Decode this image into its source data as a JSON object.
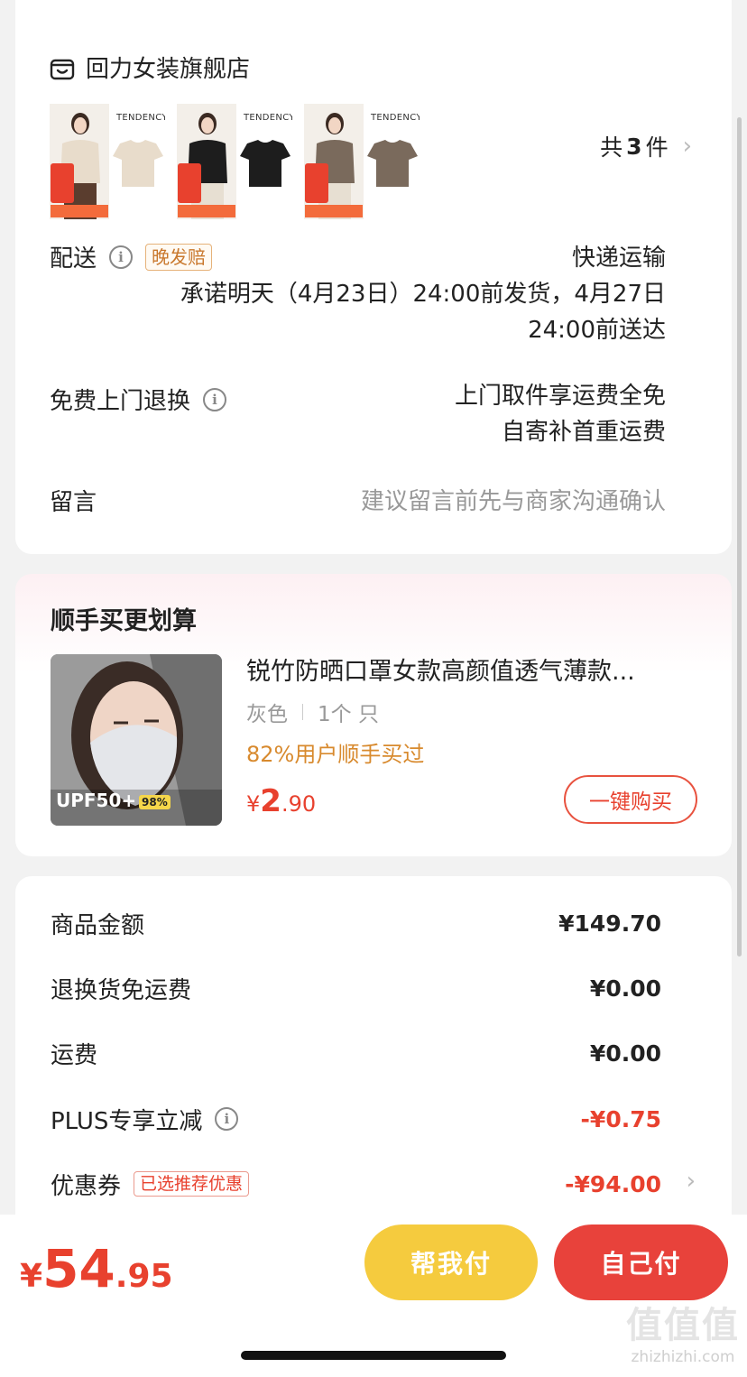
{
  "store": {
    "name": "回力女装旗舰店",
    "icon": "store-icon"
  },
  "items": {
    "thumbs": [
      {
        "brand": "TENDENCY",
        "color": "#e8dccb"
      },
      {
        "brand": "TENDENCY",
        "color": "#1d1d1d"
      },
      {
        "brand": "TENDENCY",
        "color": "#7a6a5c"
      }
    ],
    "count_prefix": "共",
    "count_num": "3",
    "count_suffix": "件"
  },
  "delivery": {
    "label": "配送",
    "badge": "晚发赔",
    "method": "快递运输",
    "line1": "承诺明天（4月23日）24:00前发货，4月27日",
    "line2": "24:00前送达"
  },
  "returns": {
    "label": "免费上门退换",
    "line1": "上门取件享运费全免",
    "line2": "自寄补首重运费"
  },
  "message": {
    "label": "留言",
    "placeholder": "建议留言前先与商家沟通确认"
  },
  "upsell": {
    "title": "顺手买更划算",
    "name": "锐竹防晒口罩女款高颜值透气薄款...",
    "spec_color": "灰色",
    "spec_qty": "1个 只",
    "rate": "82%用户顺手买过",
    "price_symbol": "¥",
    "price_int": "2",
    "price_dec": ".90",
    "button": "一键购买",
    "image_text": "UPF50+",
    "image_badge": "98%"
  },
  "fees": {
    "goods_label": "商品金额",
    "goods_value": "¥149.70",
    "return_label": "退换货免运费",
    "return_value": "¥0.00",
    "shipping_label": "运费",
    "shipping_value": "¥0.00",
    "plus_label": "PLUS专享立减",
    "plus_value": "-¥0.75",
    "coupon_label": "优惠券",
    "coupon_tag": "已选推荐优惠",
    "coupon_value": "-¥94.00"
  },
  "bottom": {
    "symbol": "¥",
    "int": "54",
    "dec": ".95",
    "help_button": "帮我付",
    "self_button": "自己付"
  },
  "watermark": {
    "big": "值值值",
    "small": "zhizhizhi.com"
  },
  "colors": {
    "accent": "#e8412e",
    "help": "#f5cb3e",
    "orange": "#d88a2e"
  }
}
